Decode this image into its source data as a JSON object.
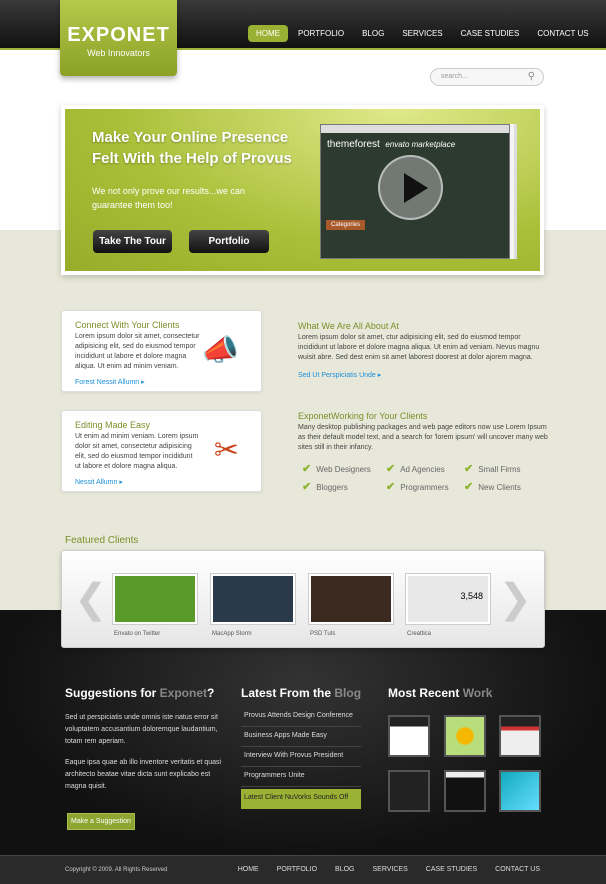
{
  "logo": {
    "title": "EXPONET",
    "subtitle": "Web Innovators"
  },
  "nav": [
    {
      "label": "HOME",
      "active": true
    },
    {
      "label": "PORTFOLIO"
    },
    {
      "label": "BLOG"
    },
    {
      "label": "SERVICES"
    },
    {
      "label": "CASE STUDIES"
    },
    {
      "label": "CONTACT US"
    }
  ],
  "search": {
    "placeholder": "search...",
    "icon": "magnifier-icon"
  },
  "hero": {
    "title_line1": "Make Your Online Presence",
    "title_line2": "Felt With the Help of Provus",
    "text": "We not only prove our results...we can guarantee them too!",
    "buttons": [
      "Take The Tour",
      "Portfolio"
    ],
    "video": {
      "brand1": "themeforest",
      "brand2": "envato marketplace",
      "menu": "Categories"
    }
  },
  "cards": [
    {
      "title": "Connect With Your Clients",
      "text": "Lorem ipsum dolor sit amet, consectetur adipisicing elit, sed do eiusmod tempor incididunt ut labore et dolore magna aliqua. Ut enim ad minim veniam.",
      "link": "Forest Nessit Allumn",
      "icon": "megaphone-icon"
    },
    {
      "title": "Editing Made Easy",
      "text": "Ut enim ad minim veniam. Lorem ipsum dolor sit amet, consectetur adipisicing elit, sed do eiusmod tempor incididunt ut labore et dolore magna aliqua.",
      "link": "Nessit Allumn",
      "icon": "scissors-icon"
    }
  ],
  "about": {
    "title": "What We Are All About At",
    "text": "Lorem ipsum dolor sit amet, ctur adipisicing elit, sed do eiusmod tempor incididunt ut labore et dolore magna aliqua. Ut enim ad veniam. Nevus magnu wuisit abre. Sed dest enim sit amet laborest doorest at dolor ajorem magna.",
    "link": "Sed Ut Perspiciatis Unde"
  },
  "working": {
    "title": "ExponetWorking for Your Clients",
    "text": "Many desktop publishing packages and web page editors now use Lorem Ipsum as their default model text, and a search for 'lorem ipsum' will uncover many web sites still in their infancy.",
    "checks": [
      "Web Designers",
      "Ad Agencies",
      "Small Firms",
      "Bloggers",
      "Programmers",
      "New Clients"
    ]
  },
  "featured": {
    "title": "Featured Clients",
    "clients": [
      {
        "label": "Envato on Twitter",
        "color": "#5a9a2a"
      },
      {
        "label": "MacApp Storm",
        "color": "#2a3a4a"
      },
      {
        "label": "PSD Tuts",
        "color": "#3a2a20"
      },
      {
        "label": "Creattica",
        "color": "#e8e8e8"
      }
    ]
  },
  "footer": {
    "suggestions": {
      "title": "Suggestions for ",
      "accent": "Exponet",
      "suffix": "?",
      "p1": "Sed ut perspiciatis unde omnis iste natus error sit voluptatem accusantium doloremque laudantium, totam rem aperiam.",
      "p2": "Eaque ipsa quae ab illo inventore veritatis et quasi architecto beatae vitae dicta sunt explicabo est magna quisit.",
      "button": "Make a Suggestion"
    },
    "blog": {
      "title": "Latest From the ",
      "accent": "Blog",
      "items": [
        "Provus Attends Design Conference",
        "Business Apps Made Easy",
        "Interview With Provus President",
        "Programmers Unite",
        "Latest Client NuVorks Sounds Off"
      ]
    },
    "work": {
      "title": "Most Recent ",
      "accent": "Work"
    }
  },
  "bottom": {
    "copyright": "Copyright © 2009. All Rights Reserved",
    "nav": [
      "HOME",
      "PORTFOLIO",
      "BLOG",
      "SERVICES",
      "CASE STUDIES",
      "CONTACT US"
    ]
  }
}
